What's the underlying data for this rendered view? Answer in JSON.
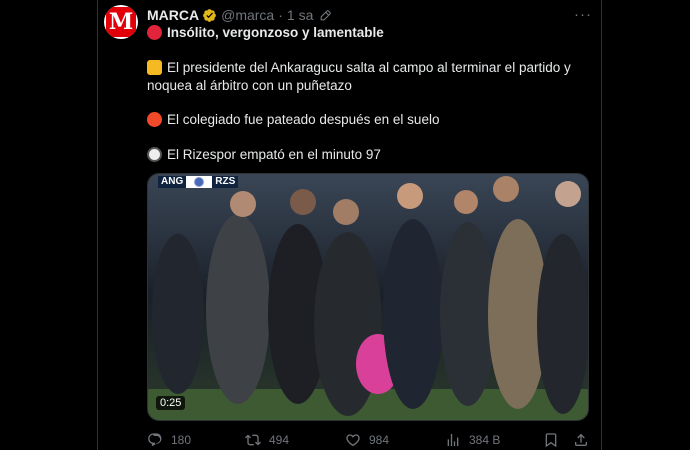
{
  "tweet": {
    "author_name": "MARCA",
    "handle": "@marca",
    "separator": "·",
    "time": "1 sa",
    "more_label": "···",
    "avatar_letter": "M",
    "lines": [
      {
        "emoji": "angry-face-emoji",
        "text": "Insólito, vergonzoso y lamentable",
        "bold": true
      },
      {
        "emoji": "fist-emoji",
        "text": "El presidente del Ankaragucu salta al campo al terminar el partido y"
      },
      {
        "emoji": "",
        "text": "noquea al árbitro con un puñetazo"
      },
      {
        "emoji": "collision-emoji",
        "text": "El colegiado fue pateado después en el suelo"
      },
      {
        "emoji": "soccer-ball-emoji",
        "text": "El Rizespor empató en el minuto 97"
      }
    ],
    "media": {
      "duration": "0:25",
      "scoreboard_home": "ANG",
      "scoreboard_away": "RZS"
    },
    "actions": {
      "replies": "180",
      "reposts": "494",
      "likes": "984",
      "views": "384 B"
    }
  },
  "colors": {
    "background": "#000000",
    "text": "#e7e9ea",
    "muted": "#71767b",
    "verified_gold": "#e2b719",
    "brand_red": "#e10009"
  }
}
